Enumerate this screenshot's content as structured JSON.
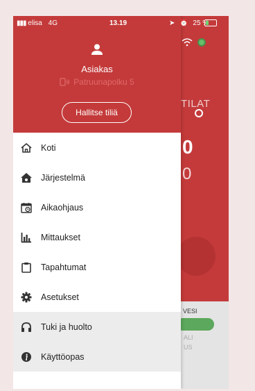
{
  "status_bar": {
    "carrier": "elisa",
    "network": "4G",
    "time": "13.19",
    "battery": "25 %",
    "battery_level": 0.25
  },
  "drawer": {
    "user_name": "Asiakas",
    "address": "Patruunapolku 5",
    "manage_button": "Hallitse tiliä",
    "items": [
      {
        "label": "Koti",
        "icon": "home-icon"
      },
      {
        "label": "Järjestelmä",
        "icon": "system-icon"
      },
      {
        "label": "Aikaohjaus",
        "icon": "schedule-icon"
      },
      {
        "label": "Mittaukset",
        "icon": "chart-icon"
      },
      {
        "label": "Tapahtumat",
        "icon": "clipboard-icon"
      },
      {
        "label": "Asetukset",
        "icon": "gear-icon"
      },
      {
        "label": "Tuki ja huolto",
        "icon": "headset-icon"
      },
      {
        "label": "Käyttöopas",
        "icon": "info-icon"
      }
    ]
  },
  "background_app": {
    "heading_fragment": "TILAT",
    "number_fragment_1": "0",
    "number_fragment_2": "0",
    "lower_label_1": "VESI",
    "lower_label_2": "ALI",
    "lower_label_3": "US"
  },
  "colors": {
    "accent": "#c43a3a",
    "status_green": "#5ca85c"
  }
}
